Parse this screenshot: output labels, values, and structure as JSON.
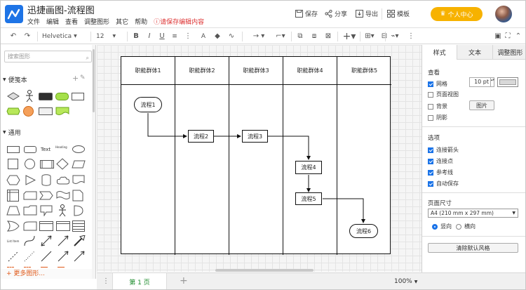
{
  "app": {
    "title": "迅捷画图-流程图"
  },
  "menu": {
    "items": [
      "文件",
      "编辑",
      "查看",
      "调整图形",
      "其它",
      "帮助"
    ],
    "warning": "请保存编辑内容"
  },
  "header": {
    "save": "保存",
    "share": "分享",
    "export": "导出",
    "template": "模板",
    "user_center": "个人中心"
  },
  "toolbar": {
    "font": "Helvetica",
    "size": "12"
  },
  "left": {
    "search_placeholder": "搜索图形",
    "section_favorites": "便笺本",
    "section_general": "通用",
    "text_shape": "Text",
    "heading_shape": "Heading",
    "list_shape": "List Item",
    "more_shapes": "更多图形..."
  },
  "lanes": [
    "职能群体1",
    "职能群体2",
    "职能群体3",
    "职能群体4",
    "职能群体5"
  ],
  "nodes": {
    "n1": "流程1",
    "n2": "流程2",
    "n3": "流程3",
    "n4": "流程4",
    "n5": "流程5",
    "n6": "流程6"
  },
  "bottom": {
    "page_tab": "第 1 页",
    "zoom": "100%"
  },
  "right": {
    "tabs": [
      "样式",
      "文本",
      "调整图形"
    ],
    "view_title": "查看",
    "grid": "网格",
    "grid_size": "10 pt",
    "page_view": "页面视图",
    "background": "背景",
    "image_btn": "图片",
    "shadow": "阴影",
    "options_title": "选项",
    "opt1": "连接箭头",
    "opt2": "连接点",
    "opt3": "参考线",
    "opt4": "自动保存",
    "page_size_title": "页面尺寸",
    "page_size": "A4 (210 mm x 297 mm)",
    "portrait": "竖向",
    "landscape": "横向",
    "clear_style": "清除默认风格"
  },
  "colors": {
    "accent": "#1e74e6",
    "user_center": "#f7b200",
    "warning": "#dd3333",
    "page_tab": "#1a8a2a"
  }
}
